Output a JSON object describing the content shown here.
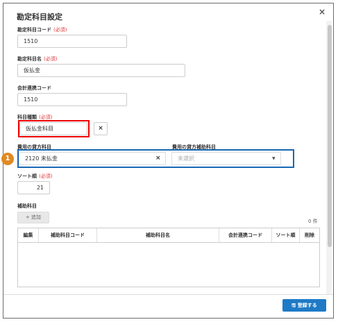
{
  "dialog": {
    "title": "勘定科目設定",
    "close_glyph": "×"
  },
  "fields": {
    "account_code": {
      "label": "勘定科目コード",
      "required": "(必須)",
      "value": "1510"
    },
    "account_name": {
      "label": "勘定科目名",
      "required": "(必須)",
      "value": "仮払金"
    },
    "link_code": {
      "label": "会計連携コード",
      "value": "1510"
    },
    "category": {
      "label": "科目種類",
      "required": "(必須)",
      "value": "仮払金科目",
      "clear": "×"
    },
    "credit_account": {
      "label": "費用の貸方科目",
      "value": "2120 未払金",
      "clear": "×"
    },
    "credit_sub_account": {
      "label": "費用の貸方補助科目",
      "placeholder": "未選択",
      "caret": "▼"
    },
    "sort_order": {
      "label": "ソート順",
      "required": "(必須)",
      "value": "21"
    }
  },
  "sub_accounts": {
    "label": "補助科目",
    "add_button": "+ 追加",
    "count": "0 件",
    "columns": [
      "編集",
      "補助科目コード",
      "補助科目名",
      "会計連携コード",
      "ソート順",
      "削除"
    ]
  },
  "annotations": {
    "badge": "1"
  },
  "footer": {
    "save_button": "🖫 登録する"
  }
}
